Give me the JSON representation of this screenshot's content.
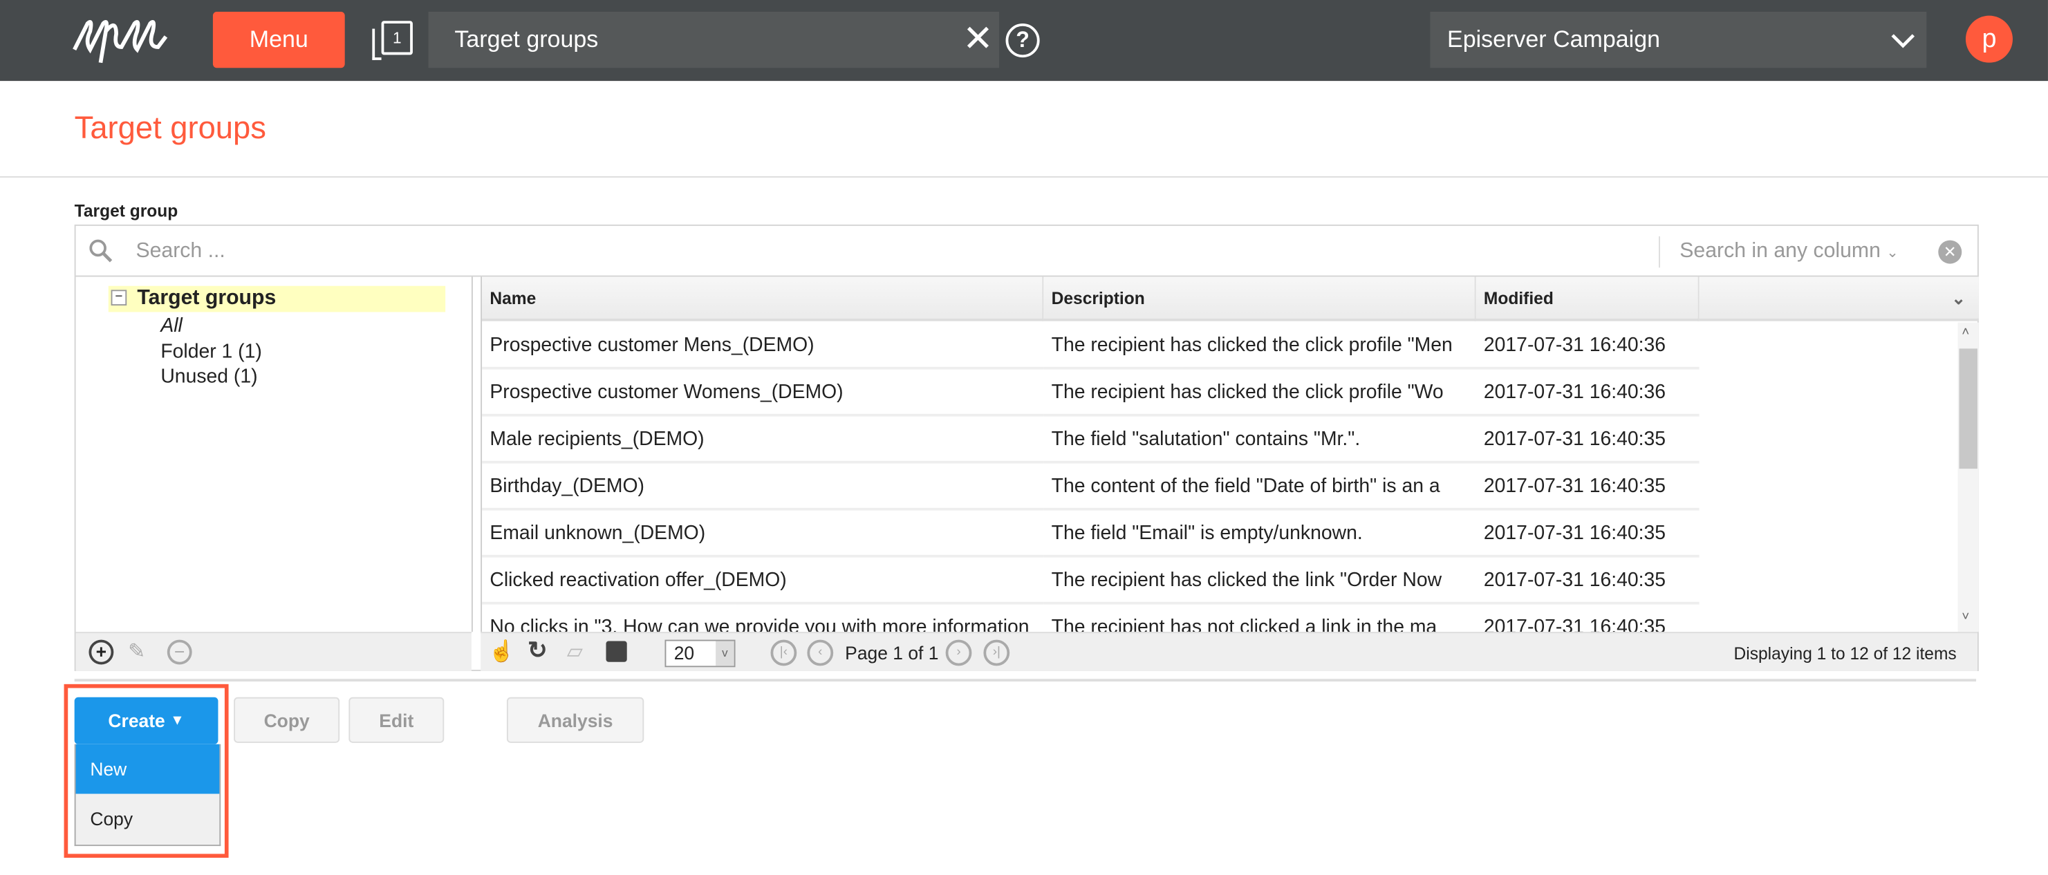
{
  "header": {
    "menu_label": "Menu",
    "tab_count": "1",
    "search_value": "Target groups",
    "site_selector": "Episerver Campaign",
    "avatar_letter": "p"
  },
  "page": {
    "title": "Target groups",
    "section_label": "Target group"
  },
  "search": {
    "placeholder": "Search ...",
    "column_filter": "Search in any column"
  },
  "tree": {
    "root": "Target groups",
    "items": [
      "All",
      "Folder 1 (1)",
      "Unused (1)"
    ]
  },
  "table": {
    "columns": [
      "Name",
      "Description",
      "Modified"
    ],
    "rows": [
      [
        "Prospective customer Mens_(DEMO)",
        "The recipient has clicked the click profile \"Men",
        "2017-07-31 16:40:36"
      ],
      [
        "Prospective customer Womens_(DEMO)",
        "The recipient has clicked the click profile \"Wo",
        "2017-07-31 16:40:36"
      ],
      [
        "Male recipients_(DEMO)",
        "The field \"salutation\" contains \"Mr.\".",
        "2017-07-31 16:40:35"
      ],
      [
        "Birthday_(DEMO)",
        "The content of the field \"Date of birth\" is an a",
        "2017-07-31 16:40:35"
      ],
      [
        "Email unknown_(DEMO)",
        "The field \"Email\" is empty/unknown.",
        "2017-07-31 16:40:35"
      ],
      [
        "Clicked reactivation offer_(DEMO)",
        "The recipient has clicked the link \"Order Now",
        "2017-07-31 16:40:35"
      ],
      [
        "No clicks in \"3. How can we provide you with more information",
        "The recipient has not clicked a link in the ma",
        "2017-07-31 16:40:35"
      ]
    ]
  },
  "pager": {
    "page_size": "20",
    "page_text": "Page 1 of 1",
    "displaying": "Displaying 1 to 12 of 12 items"
  },
  "actions": {
    "create": "Create",
    "copy": "Copy",
    "edit": "Edit",
    "analysis": "Analysis"
  },
  "create_menu": {
    "items": [
      "New",
      "Copy"
    ]
  },
  "colors": {
    "accent": "#ff5a3c",
    "primary": "#1b97ea",
    "topbar": "#464a4c"
  }
}
